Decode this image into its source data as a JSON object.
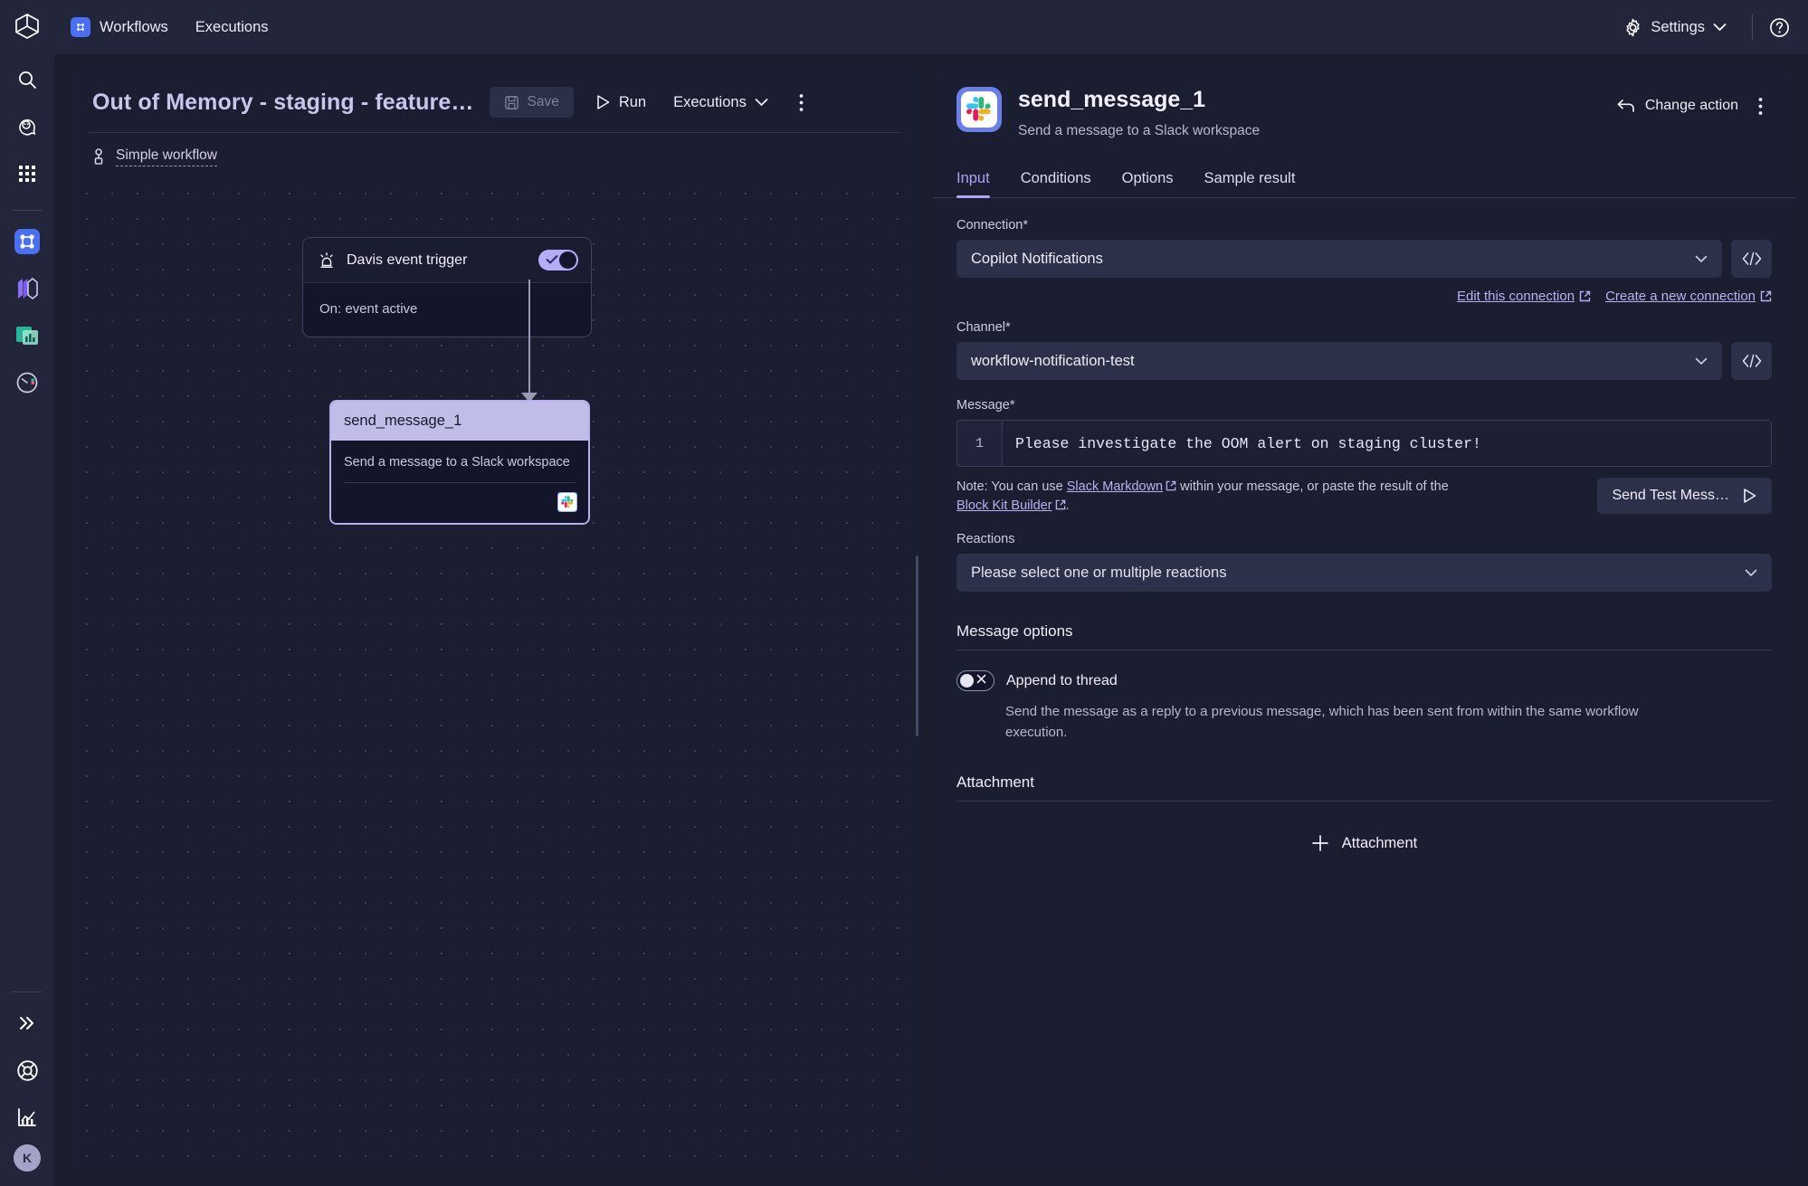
{
  "rail": {
    "logo_icon": "cube-logo-icon",
    "items": [
      {
        "name": "search-icon",
        "label": "Search"
      },
      {
        "name": "davis-copilot-icon",
        "label": "Davis CoPilot"
      },
      {
        "name": "apps-grid-icon",
        "label": "Apps"
      },
      {
        "name": "workflows-icon",
        "label": "Workflows",
        "active": true
      },
      {
        "name": "layers-icon",
        "label": "Launchpad"
      },
      {
        "name": "dashboards-icon",
        "label": "Dashboards"
      },
      {
        "name": "clock-icon",
        "label": "Recents"
      }
    ],
    "bottom_items": [
      {
        "name": "chevrons-right-icon",
        "label": "Expand"
      },
      {
        "name": "lifebuoy-icon",
        "label": "Support"
      },
      {
        "name": "chart-icon",
        "label": "Metrics"
      }
    ],
    "avatar_initial": "K"
  },
  "topbar": {
    "nav": [
      {
        "label": "Workflows",
        "icon": "workflows-icon"
      },
      {
        "label": "Executions",
        "icon": null
      }
    ],
    "settings_label": "Settings",
    "settings_icon": "gear-icon",
    "help_icon": "question-circle-icon"
  },
  "workflow": {
    "title": "Out of Memory - staging - feature…",
    "save_label": "Save",
    "save_icon": "floppy-disk-icon",
    "run_label": "Run",
    "run_icon": "play-icon",
    "executions_label": "Executions",
    "kebab_icon": "more-vertical-icon",
    "subtitle": "Simple workflow",
    "subtitle_icon": "workflow-node-icon",
    "nodes": {
      "trigger": {
        "title": "Davis event trigger",
        "icon": "alarm-light-icon",
        "toggle_on": true,
        "body": "On: event active"
      },
      "action": {
        "title": "send_message_1",
        "description": "Send a message to a Slack workspace",
        "icon": "slack-icon"
      }
    }
  },
  "panel": {
    "icon": "slack-icon",
    "title": "send_message_1",
    "subtitle": "Send a message to a Slack workspace",
    "change_action_label": "Change action",
    "change_action_icon": "arrow-back-icon",
    "kebab_icon": "more-vertical-icon",
    "tabs": [
      {
        "label": "Input",
        "active": true
      },
      {
        "label": "Conditions",
        "active": false
      },
      {
        "label": "Options",
        "active": false
      },
      {
        "label": "Sample result",
        "active": false
      }
    ],
    "connection": {
      "label": "Connection*",
      "value": "Copilot Notifications",
      "code_icon": "code-brackets-icon",
      "caret_icon": "chevron-down-icon",
      "edit_link": "Edit this connection",
      "create_link": "Create a new connection",
      "external_icon": "external-link-icon"
    },
    "channel": {
      "label": "Channel*",
      "value": "workflow-notification-test",
      "code_icon": "code-brackets-icon",
      "caret_icon": "chevron-down-icon"
    },
    "message": {
      "label": "Message*",
      "line_number": "1",
      "value": "Please investigate the OOM alert on staging cluster!",
      "note_prefix": "Note: You can use ",
      "note_link1": "Slack Markdown",
      "note_middle": " within your message, or paste the result of the ",
      "note_link2": "Block Kit Builder",
      "note_suffix": ".",
      "send_test_label": "Send Test Mess…",
      "send_test_icon": "play-icon"
    },
    "reactions": {
      "label": "Reactions",
      "placeholder": "Please select one or multiple reactions",
      "caret_icon": "chevron-down-icon"
    },
    "message_options": {
      "title": "Message options",
      "toggle_label": "Append to thread",
      "toggle_on": false,
      "description": "Send the message as a reply to a previous message, which has been sent from within the same workflow execution."
    },
    "attachment": {
      "title": "Attachment",
      "button_label": "Attachment",
      "plus_icon": "plus-icon"
    }
  },
  "colors": {
    "accent": "#aaa4f8",
    "bg": "#1b1d2e",
    "panel_bg": "#1b1e30",
    "rail_bg": "#23263b",
    "field_bg": "#2c3048",
    "node_selected": "#c1bde9"
  }
}
